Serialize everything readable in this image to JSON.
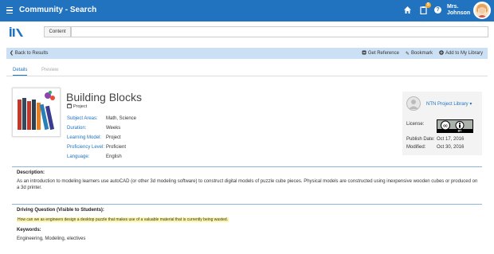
{
  "header": {
    "title": "Community - Search",
    "notification_count": "5",
    "user_line1": "Mrs.",
    "user_line2": "Johnson"
  },
  "search": {
    "label": "Content",
    "value": "",
    "placeholder": ""
  },
  "action_bar": {
    "back_label": "Back to Results",
    "get_reference": "Get Reference",
    "bookmark": "Bookmark",
    "add_to_library": "Add to My Library"
  },
  "tabs": [
    {
      "label": "Details",
      "active": true
    },
    {
      "label": "Preview",
      "active": false
    }
  ],
  "resource": {
    "title": "Building Blocks",
    "type": "Project",
    "meta": [
      {
        "key": "Subject Areas:",
        "value": "Math, Science"
      },
      {
        "key": "Duration:",
        "value": "Weeks"
      },
      {
        "key": "Learning Model:",
        "value": "Project"
      },
      {
        "key": "Proficiency Level:",
        "value": "Proficient"
      },
      {
        "key": "Language:",
        "value": "English"
      }
    ]
  },
  "library_panel": {
    "library_name": "NTN Project Library",
    "license_label": "License:",
    "license_cc": "cc",
    "license_by": "BY",
    "publish_label": "Publish Date:",
    "publish_date": "Oct 17, 2016",
    "modified_label": "Modified:",
    "modified_date": "Oct 30, 2016"
  },
  "description": {
    "heading": "Description:",
    "text": "As an introduction to modeling learners use autoCAD (or other 3d modeling software) to construct digital models of puzzle cube pieces. Physical models are constructed using inexpensive wooden cubes or produced on a 3d printer."
  },
  "driving_question": {
    "heading": "Driving Question (Visible to Students):",
    "text": "How can we as engineers design a desktop puzzle that makes use of a valuable material that is currently being wasted."
  },
  "keywords": {
    "heading": "Keywords:",
    "text": "Engineering, Modeling, electives"
  },
  "colors": {
    "primary": "#2273bf",
    "action_bar": "#cbe0f4",
    "highlight": "#fdf6a8",
    "badge": "#f0a928"
  },
  "icons": [
    "hamburger-icon",
    "home-icon",
    "clipboard-icon",
    "help-icon",
    "chevron-left-icon",
    "reference-icon",
    "bookmark-icon",
    "plus-circle-icon",
    "project-icon",
    "caret-down-icon"
  ]
}
